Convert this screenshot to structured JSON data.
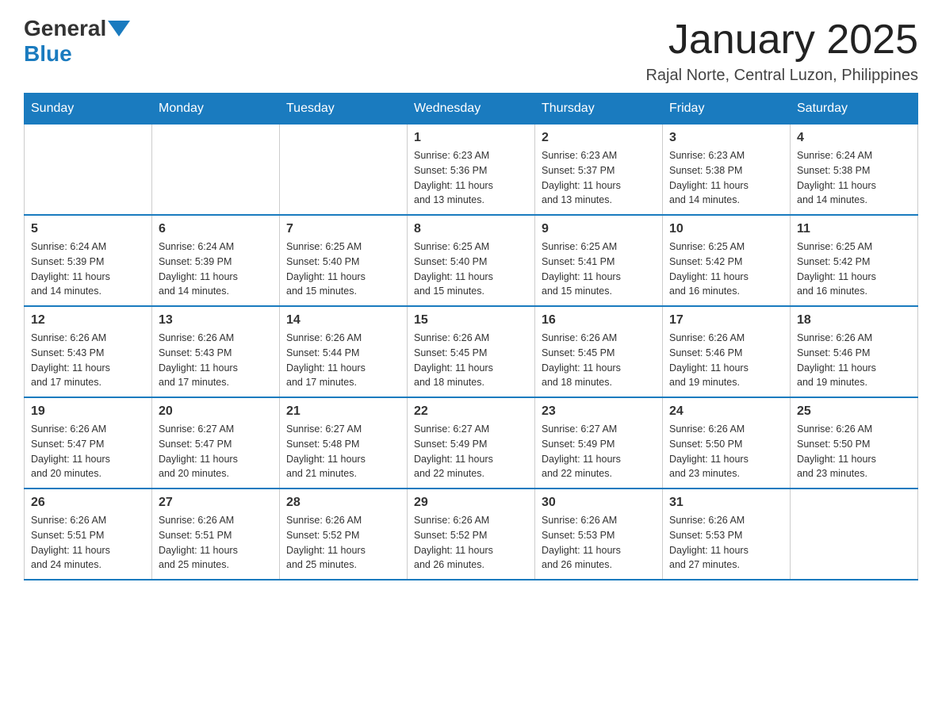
{
  "logo": {
    "general": "General",
    "blue": "Blue"
  },
  "header": {
    "title": "January 2025",
    "location": "Rajal Norte, Central Luzon, Philippines"
  },
  "weekdays": [
    "Sunday",
    "Monday",
    "Tuesday",
    "Wednesday",
    "Thursday",
    "Friday",
    "Saturday"
  ],
  "weeks": [
    [
      {
        "day": "",
        "info": ""
      },
      {
        "day": "",
        "info": ""
      },
      {
        "day": "",
        "info": ""
      },
      {
        "day": "1",
        "info": "Sunrise: 6:23 AM\nSunset: 5:36 PM\nDaylight: 11 hours\nand 13 minutes."
      },
      {
        "day": "2",
        "info": "Sunrise: 6:23 AM\nSunset: 5:37 PM\nDaylight: 11 hours\nand 13 minutes."
      },
      {
        "day": "3",
        "info": "Sunrise: 6:23 AM\nSunset: 5:38 PM\nDaylight: 11 hours\nand 14 minutes."
      },
      {
        "day": "4",
        "info": "Sunrise: 6:24 AM\nSunset: 5:38 PM\nDaylight: 11 hours\nand 14 minutes."
      }
    ],
    [
      {
        "day": "5",
        "info": "Sunrise: 6:24 AM\nSunset: 5:39 PM\nDaylight: 11 hours\nand 14 minutes."
      },
      {
        "day": "6",
        "info": "Sunrise: 6:24 AM\nSunset: 5:39 PM\nDaylight: 11 hours\nand 14 minutes."
      },
      {
        "day": "7",
        "info": "Sunrise: 6:25 AM\nSunset: 5:40 PM\nDaylight: 11 hours\nand 15 minutes."
      },
      {
        "day": "8",
        "info": "Sunrise: 6:25 AM\nSunset: 5:40 PM\nDaylight: 11 hours\nand 15 minutes."
      },
      {
        "day": "9",
        "info": "Sunrise: 6:25 AM\nSunset: 5:41 PM\nDaylight: 11 hours\nand 15 minutes."
      },
      {
        "day": "10",
        "info": "Sunrise: 6:25 AM\nSunset: 5:42 PM\nDaylight: 11 hours\nand 16 minutes."
      },
      {
        "day": "11",
        "info": "Sunrise: 6:25 AM\nSunset: 5:42 PM\nDaylight: 11 hours\nand 16 minutes."
      }
    ],
    [
      {
        "day": "12",
        "info": "Sunrise: 6:26 AM\nSunset: 5:43 PM\nDaylight: 11 hours\nand 17 minutes."
      },
      {
        "day": "13",
        "info": "Sunrise: 6:26 AM\nSunset: 5:43 PM\nDaylight: 11 hours\nand 17 minutes."
      },
      {
        "day": "14",
        "info": "Sunrise: 6:26 AM\nSunset: 5:44 PM\nDaylight: 11 hours\nand 17 minutes."
      },
      {
        "day": "15",
        "info": "Sunrise: 6:26 AM\nSunset: 5:45 PM\nDaylight: 11 hours\nand 18 minutes."
      },
      {
        "day": "16",
        "info": "Sunrise: 6:26 AM\nSunset: 5:45 PM\nDaylight: 11 hours\nand 18 minutes."
      },
      {
        "day": "17",
        "info": "Sunrise: 6:26 AM\nSunset: 5:46 PM\nDaylight: 11 hours\nand 19 minutes."
      },
      {
        "day": "18",
        "info": "Sunrise: 6:26 AM\nSunset: 5:46 PM\nDaylight: 11 hours\nand 19 minutes."
      }
    ],
    [
      {
        "day": "19",
        "info": "Sunrise: 6:26 AM\nSunset: 5:47 PM\nDaylight: 11 hours\nand 20 minutes."
      },
      {
        "day": "20",
        "info": "Sunrise: 6:27 AM\nSunset: 5:47 PM\nDaylight: 11 hours\nand 20 minutes."
      },
      {
        "day": "21",
        "info": "Sunrise: 6:27 AM\nSunset: 5:48 PM\nDaylight: 11 hours\nand 21 minutes."
      },
      {
        "day": "22",
        "info": "Sunrise: 6:27 AM\nSunset: 5:49 PM\nDaylight: 11 hours\nand 22 minutes."
      },
      {
        "day": "23",
        "info": "Sunrise: 6:27 AM\nSunset: 5:49 PM\nDaylight: 11 hours\nand 22 minutes."
      },
      {
        "day": "24",
        "info": "Sunrise: 6:26 AM\nSunset: 5:50 PM\nDaylight: 11 hours\nand 23 minutes."
      },
      {
        "day": "25",
        "info": "Sunrise: 6:26 AM\nSunset: 5:50 PM\nDaylight: 11 hours\nand 23 minutes."
      }
    ],
    [
      {
        "day": "26",
        "info": "Sunrise: 6:26 AM\nSunset: 5:51 PM\nDaylight: 11 hours\nand 24 minutes."
      },
      {
        "day": "27",
        "info": "Sunrise: 6:26 AM\nSunset: 5:51 PM\nDaylight: 11 hours\nand 25 minutes."
      },
      {
        "day": "28",
        "info": "Sunrise: 6:26 AM\nSunset: 5:52 PM\nDaylight: 11 hours\nand 25 minutes."
      },
      {
        "day": "29",
        "info": "Sunrise: 6:26 AM\nSunset: 5:52 PM\nDaylight: 11 hours\nand 26 minutes."
      },
      {
        "day": "30",
        "info": "Sunrise: 6:26 AM\nSunset: 5:53 PM\nDaylight: 11 hours\nand 26 minutes."
      },
      {
        "day": "31",
        "info": "Sunrise: 6:26 AM\nSunset: 5:53 PM\nDaylight: 11 hours\nand 27 minutes."
      },
      {
        "day": "",
        "info": ""
      }
    ]
  ],
  "colors": {
    "header_bg": "#1a7bbf",
    "header_text": "#ffffff",
    "border": "#1a7bbf",
    "cell_border": "#cccccc"
  }
}
